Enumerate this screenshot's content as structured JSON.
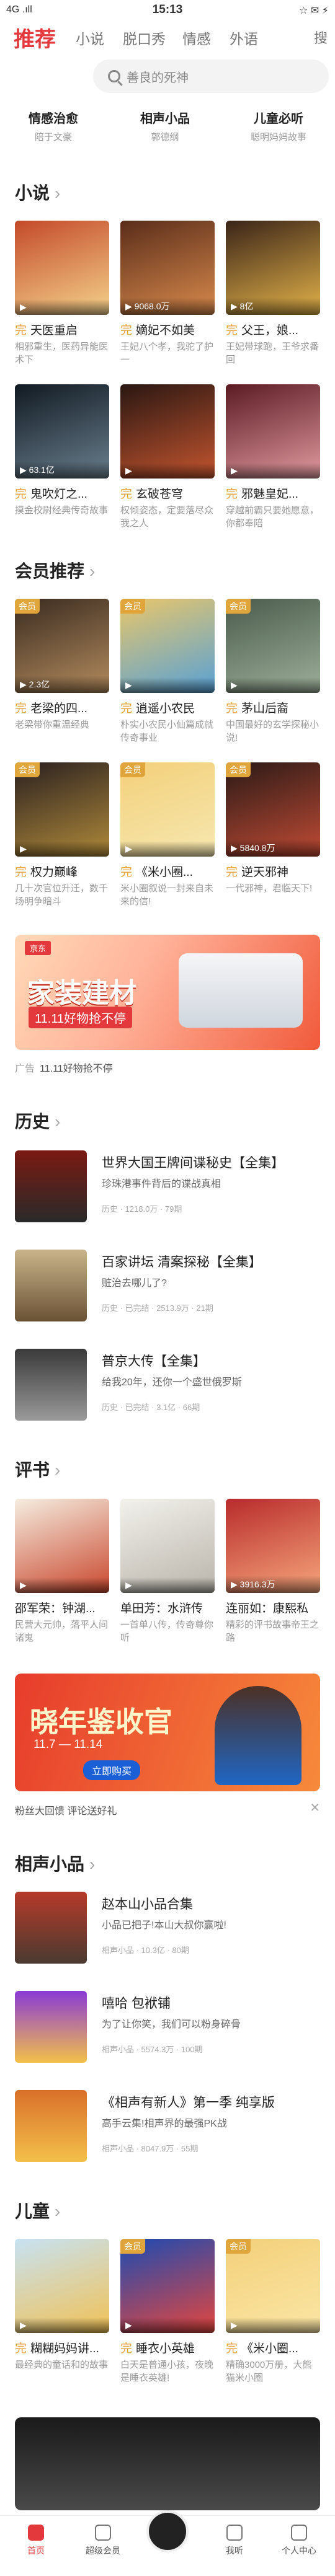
{
  "status": {
    "left": "4G .ıll",
    "time": "15:13",
    "right": "☆ ✉ ⚡"
  },
  "tabs": [
    "推荐",
    "小说",
    "脱口秀",
    "情感",
    "外语",
    "搜"
  ],
  "search": {
    "placeholder": "善良的死神"
  },
  "categories": [
    {
      "title": "情感治愈",
      "sub": "陪于文豪"
    },
    {
      "title": "相声小品",
      "sub": "郭德纲"
    },
    {
      "title": "儿童必听",
      "sub": "聪明妈妈故事"
    }
  ],
  "novel": {
    "title": "小说",
    "items": [
      {
        "title": "天医重启",
        "desc": "相邪重生，医药异能医术下",
        "plays": "",
        "grad": "#c44a2a,#f4d28b"
      },
      {
        "title": "嫡妃不如美",
        "desc": "王妃八个孝，我驼了护一",
        "plays": "9068.0万",
        "grad": "#5a2d1a,#d98a4c"
      },
      {
        "title": "父王，娘...",
        "desc": "王妃带球跑，王爷求番回",
        "plays": "8亿",
        "grad": "#3a2418,#e4b34a"
      },
      {
        "title": "鬼吹灯之...",
        "desc": "摸金校尉经典传奇故事",
        "plays": "63.1亿",
        "grad": "#111a22,#6a7f8e"
      },
      {
        "title": "玄破苍穹",
        "desc": "权倾姿态，定要落尽众我之人",
        "plays": "",
        "grad": "#2a1712,#c4552f"
      },
      {
        "title": "邪魅皇妃...",
        "desc": "穿越前霸只要她愿意，你都奉陪",
        "plays": "",
        "grad": "#5b1a22,#e19aa0"
      }
    ]
  },
  "member": {
    "title": "会员推荐",
    "items": [
      {
        "title": "老梁的四...",
        "desc": "老梁带你重温经典",
        "plays": "2.3亿",
        "grad": "#3a2b20,#b48c5e",
        "badge": "会员"
      },
      {
        "title": "逍遥小农民",
        "desc": "朴实小农民小仙篇成就传奇事业",
        "plays": "",
        "grad": "#e9c66a,#57a1d6",
        "badge": "会员"
      },
      {
        "title": "茅山后裔",
        "desc": "中国最好的玄学探秘小说!",
        "plays": "",
        "grad": "#4a5b4c,#9db09a",
        "badge": "会员"
      },
      {
        "title": "权力巅峰",
        "desc": "几十次官位升迁，数千场明争暗斗",
        "plays": "",
        "grad": "#2a2020,#b08a3a",
        "badge": "会员"
      },
      {
        "title": "《米小圈...",
        "desc": "米小圈叙说一封来自未来的信!",
        "plays": "",
        "grad": "#f3d07a,#f6e7b0",
        "badge": "会员"
      },
      {
        "title": "逆天邪神",
        "desc": "一代邪神，君临天下!",
        "plays": "5840.8万",
        "grad": "#2a1a16,#c14b35",
        "badge": "会员"
      }
    ]
  },
  "ad1": {
    "caption": "11.11好物抢不停",
    "adlabel": "广告",
    "headline": "家装建材",
    "sub": "11.11好物抢不停",
    "brand": "京东"
  },
  "history": {
    "title": "历史",
    "items": [
      {
        "title": "世界大国王牌间谍秘史【全集】",
        "desc": "珍珠港事件背后的谍战真相",
        "meta": "历史 · 1218.0万 · 79期",
        "hi": ""
      },
      {
        "title": "百家讲坛 清案探秘【全集】",
        "desc": "赃治去哪儿了?",
        "meta": "历史 · 已完结 · 2513.9万 · 21期",
        "hi": "已完结"
      },
      {
        "title": "普京大传【全集】",
        "desc": "给我20年，还你一个盛世俄罗斯",
        "meta": "历史 · 已完结 · 3.1亿 · 66期",
        "hi": "已完结"
      }
    ]
  },
  "pingshu": {
    "title": "评书",
    "items": [
      {
        "title": "邵军荣：钟湖...",
        "desc": "民营大元帅，落平人间诸鬼",
        "plays": "",
        "grad": "#f5ede0,#c9472d"
      },
      {
        "title": "单田芳：水浒传",
        "desc": "一首单八传，传奇尊你听",
        "plays": "",
        "grad": "#f3f1ec,#b8b4aa"
      },
      {
        "title": "连丽如：康熙私",
        "desc": "精彩的评书故事帝王之路",
        "plays": "3916.3万",
        "grad": "#b82b2b,#f6a67c"
      }
    ]
  },
  "ad2": {
    "caption": "粉丝大回馈 评论送好礼",
    "sub": "晓年鉴收官",
    "date": "11.7 — 11.14",
    "btn": "立即购买"
  },
  "xiangsheng": {
    "title": "相声小品",
    "items": [
      {
        "title": "赵本山小品合集",
        "desc": "小品已把子!本山大叔你赢啦!",
        "meta": "相声小品 · 10.3亿 · 80期",
        "hi": ""
      },
      {
        "title": "嘻哈 包袱铺",
        "desc": "为了让你笑，我们可以粉身碎骨",
        "meta": "相声小品 · 5574.3万 · 100期",
        "hi": ""
      },
      {
        "title": "《相声有新人》第一季 纯享版",
        "desc": "高手云集!相声界的最强PK战",
        "meta": "相声小品 · 8047.9万 · 55期",
        "hi": ""
      }
    ]
  },
  "children": {
    "title": "儿童",
    "items": [
      {
        "title": "糊糊妈妈讲...",
        "desc": "最经典的童话和的故事",
        "plays": "",
        "grad": "#c7e2f3,#f1c154",
        "badge": ""
      },
      {
        "title": "睡衣小英雄",
        "desc": "白天是普通小孩，夜晚是睡衣英雄!",
        "plays": "",
        "grad": "#1b4bb3,#e5463d",
        "badge": "会员"
      },
      {
        "title": "《米小圈...",
        "desc": "精确3000万册，大熊猫米小圈",
        "plays": "",
        "grad": "#f3d07a,#fbe6a5",
        "badge": "会员"
      }
    ]
  },
  "bottom": [
    "首页",
    "超级会员",
    "",
    "我听",
    "个人中心"
  ]
}
